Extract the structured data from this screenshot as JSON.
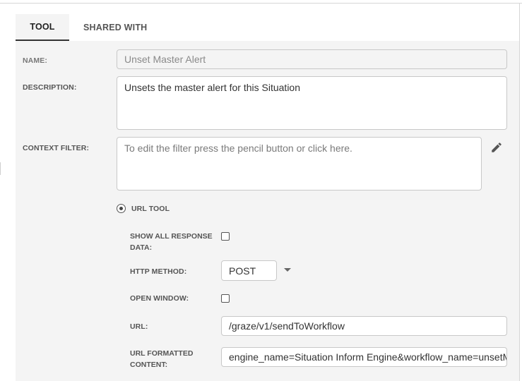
{
  "tabs": [
    {
      "label": "TOOL"
    },
    {
      "label": "SHARED WITH"
    }
  ],
  "form": {
    "name": {
      "label": "NAME:",
      "value": "Unset Master Alert"
    },
    "description": {
      "label": "DESCRIPTION:",
      "value": "Unsets the master alert for this Situation"
    },
    "context_filter": {
      "label": "CONTEXT FILTER:",
      "placeholder": "To edit the filter press the pencil button or click here."
    },
    "url_tool": {
      "label": "URL TOOL",
      "selected": true
    },
    "show_all_response": {
      "label_line1": "SHOW ALL RESPONSE",
      "label_line2": "DATA:",
      "checked": false
    },
    "http_method": {
      "label": "HTTP METHOD:",
      "value": "POST"
    },
    "open_window": {
      "label": "OPEN WINDOW:",
      "checked": false
    },
    "url": {
      "label": "URL:",
      "value": "/graze/v1/sendToWorkflow"
    },
    "url_formatted_content": {
      "label_line1": "URL FORMATTED",
      "label_line2": "CONTENT:",
      "value": "engine_name=Situation Inform Engine&workflow_name=unsetMa"
    }
  },
  "icons": {
    "edit": "pencil-icon",
    "dropdown": "chevron-down-icon"
  }
}
